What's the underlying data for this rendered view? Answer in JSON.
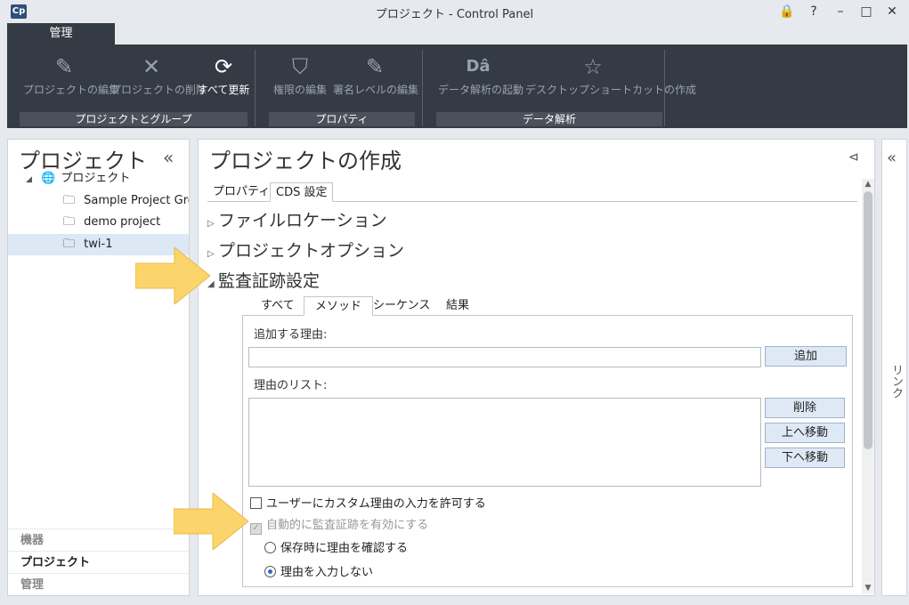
{
  "window": {
    "logo": "Cp",
    "title": "プロジェクト - Control Panel",
    "buttons": {
      "lock": "🔒",
      "help": "?",
      "minimize": "–",
      "maximize": "□",
      "close": "✕"
    }
  },
  "ribbon": {
    "tab_label": "管理",
    "buttons": [
      {
        "label": "プロジェクトの編集",
        "icon": "pencil-icon",
        "glyph": "✎",
        "active": false
      },
      {
        "label": "プロジェクトの削除",
        "icon": "x-icon",
        "glyph": "✕",
        "active": false
      },
      {
        "label": "すべて更新",
        "icon": "refresh-icon",
        "glyph": "⟳",
        "active": true
      },
      {
        "label": "権限の編集",
        "icon": "shield-icon",
        "glyph": "⛉",
        "active": false
      },
      {
        "label": "署名レベルの編集",
        "icon": "pencil-icon",
        "glyph": "✎",
        "active": false
      },
      {
        "label": "データ解析の起動",
        "icon": "data-analysis-icon",
        "glyph": "Dâ",
        "active": false
      },
      {
        "label": "デスクトップショートカットの作成",
        "icon": "star-icon",
        "glyph": "☆",
        "active": false
      }
    ],
    "groups": [
      "プロジェクトとグループ",
      "プロパティ",
      "データ解析"
    ]
  },
  "left_panel": {
    "title": "プロジェクト",
    "collapse_glyph": "«",
    "tree": [
      {
        "label": "プロジェクト",
        "icon": "globe-icon",
        "glyph": "🌐",
        "expand": "◢",
        "level": 0,
        "selected": false
      },
      {
        "label": "Sample Project Group",
        "icon": "folder-icon",
        "glyph": "🗀",
        "level": 1,
        "selected": false
      },
      {
        "label": "demo project",
        "icon": "folder-icon",
        "glyph": "🗀",
        "level": 1,
        "selected": false
      },
      {
        "label": "twi-1",
        "icon": "folder-icon",
        "glyph": "🗀",
        "level": 1,
        "selected": true
      }
    ],
    "bottom_nav": [
      {
        "label": "機器",
        "active": false
      },
      {
        "label": "プロジェクト",
        "active": true
      },
      {
        "label": "管理",
        "active": false
      }
    ]
  },
  "main_panel": {
    "title": "プロジェクトの作成",
    "pin_glyph": "⊲",
    "tabs": [
      {
        "label": "プロパティ",
        "active": false
      },
      {
        "label": "CDS 設定",
        "active": true
      }
    ],
    "sections": [
      {
        "label": "ファイルロケーション",
        "expanded": false,
        "tri": "▷"
      },
      {
        "label": "プロジェクトオプション",
        "expanded": false,
        "tri": "▷"
      },
      {
        "label": "監査証跡設定",
        "expanded": true,
        "tri": "◢"
      }
    ],
    "sub_tabs": [
      {
        "label": "すべて",
        "active": false
      },
      {
        "label": "メソッド",
        "active": true
      },
      {
        "label": "シーケンス",
        "active": false
      },
      {
        "label": "結果",
        "active": false
      }
    ],
    "reason_to_add_label": "追加する理由:",
    "reason_input_value": "",
    "add_button": "追加",
    "reason_list_label": "理由のリスト:",
    "delete_button": "削除",
    "move_up_button": "上へ移動",
    "move_down_button": "下へ移動",
    "allow_custom_reason": {
      "label": "ユーザーにカスタム理由の入力を許可する",
      "checked": false
    },
    "auto_enable_audit": {
      "label": "自動的に監査証跡を有効にする",
      "checked": true,
      "disabled": true
    },
    "radio_confirm_on_save": {
      "label": "保存時に理由を確認する",
      "selected": false
    },
    "radio_no_reason": {
      "label": "理由を入力しない",
      "selected": true
    }
  },
  "right_panel": {
    "collapse_glyph": "«",
    "link_label": "リンク"
  },
  "colors": {
    "ribbon_bg": "#353b44",
    "selection": "#dce8f5",
    "button_bg": "#dfe9f6",
    "highlight_arrow": "#fbd56b"
  }
}
